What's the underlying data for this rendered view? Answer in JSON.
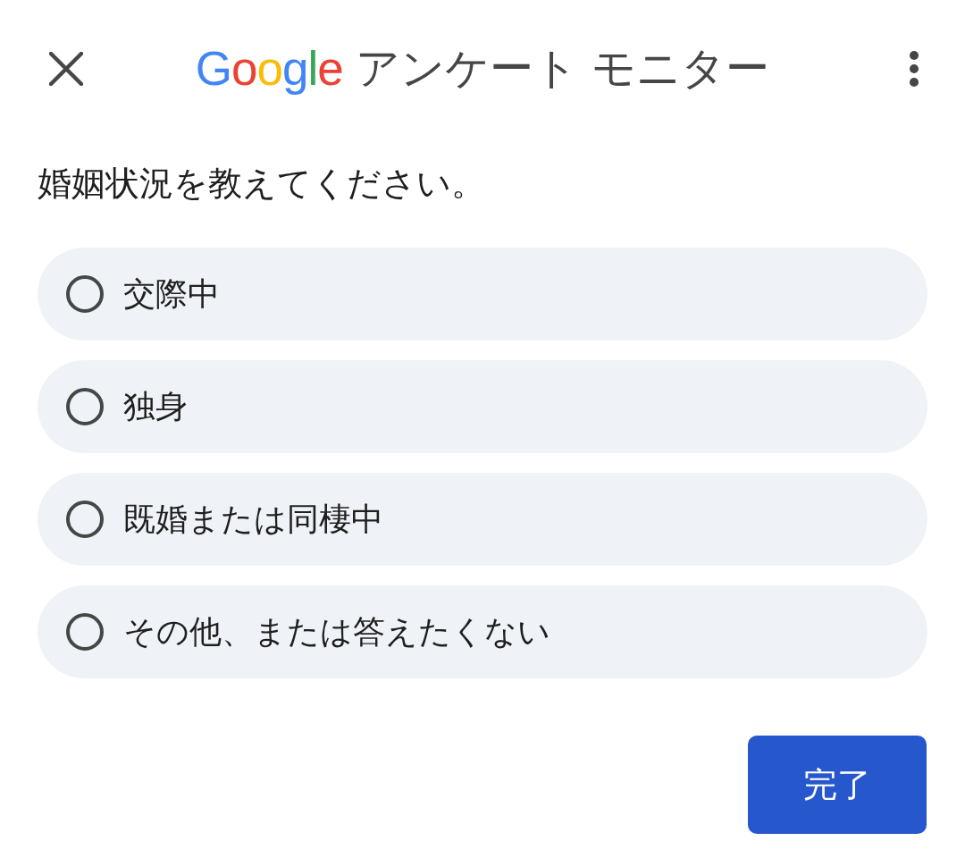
{
  "header": {
    "logo": "Google",
    "title": "アンケート モニター"
  },
  "question": "婚姻状況を教えてください。",
  "options": [
    {
      "label": "交際中",
      "selected": false
    },
    {
      "label": "独身",
      "selected": false
    },
    {
      "label": "既婚または同棲中",
      "selected": false
    },
    {
      "label": "その他、または答えたくない",
      "selected": false
    }
  ],
  "done_button": "完了"
}
